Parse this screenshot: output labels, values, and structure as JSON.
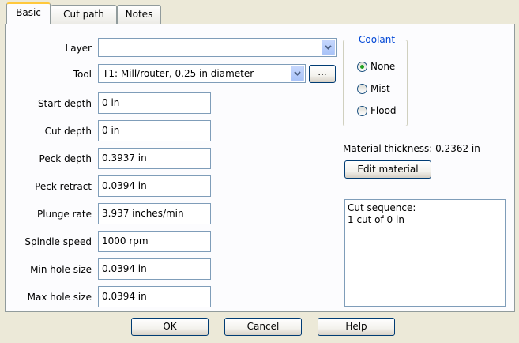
{
  "tabs": [
    {
      "label": "Basic",
      "active": true
    },
    {
      "label": "Cut path",
      "active": false
    },
    {
      "label": "Notes",
      "active": false
    }
  ],
  "layer": {
    "label": "Layer",
    "value": ""
  },
  "tool": {
    "label": "Tool",
    "value": "T1: Mill/router, 0.25 in diameter",
    "browse_label": "..."
  },
  "fields": [
    {
      "label": "Start depth",
      "value": "0 in"
    },
    {
      "label": "Cut depth",
      "value": "0 in"
    },
    {
      "label": "Peck depth",
      "value": "0.3937 in"
    },
    {
      "label": "Peck retract",
      "value": "0.0394 in"
    },
    {
      "label": "Plunge rate",
      "value": "3.937 inches/min"
    },
    {
      "label": "Spindle speed",
      "value": "1000 rpm"
    },
    {
      "label": "Min hole size",
      "value": "0.0394 in"
    },
    {
      "label": "Max hole size",
      "value": "0.0394 in"
    }
  ],
  "coolant": {
    "title": "Coolant",
    "options": [
      {
        "label": "None",
        "checked": true
      },
      {
        "label": "Mist",
        "checked": false
      },
      {
        "label": "Flood",
        "checked": false
      }
    ]
  },
  "material": {
    "thickness_text": "Material thickness: 0.2362 in",
    "edit_label": "Edit material"
  },
  "cut_sequence": {
    "line1": "Cut sequence:",
    "line2": "1 cut of 0 in"
  },
  "footer": {
    "ok": "OK",
    "cancel": "Cancel",
    "help": "Help"
  },
  "colors": {
    "accent": "#0046d5",
    "tab_highlight": "#ffc83c",
    "radio_dot": "#21a121"
  }
}
